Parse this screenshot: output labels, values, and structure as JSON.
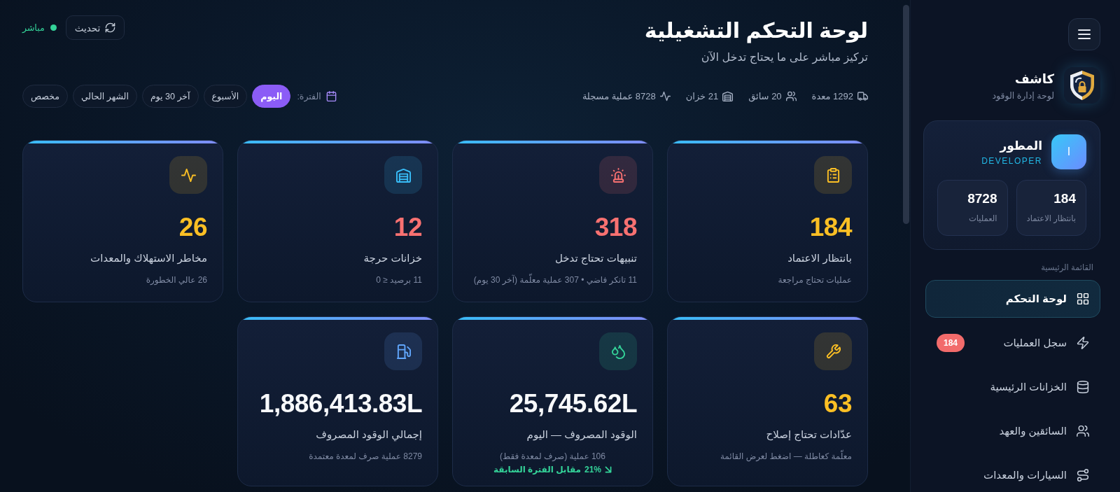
{
  "sidebar": {
    "brand": {
      "name": "كاشف",
      "tagline": "لوحة إدارة الوقود"
    },
    "user": {
      "avatar": "I",
      "name": "المطور",
      "role": "DEVELOPER",
      "stats": [
        {
          "value": "184",
          "label": "بانتظار الاعتماد"
        },
        {
          "value": "8728",
          "label": "العمليات"
        }
      ]
    },
    "menu_title": "القائمة الرئيسية",
    "items": [
      {
        "label": "لوحة التحكم",
        "selected": true
      },
      {
        "label": "سجل العمليات",
        "selected": false,
        "badge": "184"
      },
      {
        "label": "الخزانات الرئيسية",
        "selected": false
      },
      {
        "label": "السائقين والعهد",
        "selected": false
      },
      {
        "label": "السيارات والمعدات",
        "selected": false
      }
    ]
  },
  "header": {
    "title": "لوحة التحكم التشغيلية",
    "subtitle": "تركيز مباشر على ما يحتاج تدخل الآن",
    "refresh_button": "تحديث",
    "live": {
      "label": "مباشر",
      "on": true
    }
  },
  "summary": [
    "1292 معدة",
    "20 سائق",
    "21 خزان",
    "8728 عملية مسجلة"
  ],
  "period": {
    "label": "الفترة:",
    "options": [
      {
        "label": "اليوم",
        "selected": true
      },
      {
        "label": "الأسبوع",
        "selected": false
      },
      {
        "label": "آخر 30 يوم",
        "selected": false
      },
      {
        "label": "الشهر الحالي",
        "selected": false
      },
      {
        "label": "مخصص",
        "selected": false
      }
    ]
  },
  "cards": [
    {
      "kind": "warning",
      "value": "184",
      "label": "بانتظار الاعتماد",
      "note": "عمليات تحتاج مراجعة",
      "color": "#fbbf24"
    },
    {
      "kind": "danger",
      "value": "318",
      "label": "تنبيهات تحتاج تدخل",
      "note": "11 تانكر فاضي • 307 عملية معلّمة (آخر 30 يوم)",
      "color": "#f87171"
    },
    {
      "kind": "danger",
      "value": "12",
      "label": "خزانات حرجة",
      "note": "11 برصيد ≤ 0",
      "color": "#38bdf8"
    },
    {
      "kind": "warning",
      "value": "26",
      "label": "مخاطر الاستهلاك والمعدات",
      "note": "26 عالي الخطورة",
      "color": "#fbbf24"
    },
    {
      "kind": "warning",
      "value": "63",
      "label": "عدّادات تحتاج إصلاح",
      "note": "معلّمة كعاطلة — اضغط لعرض القائمة",
      "color": "#fbbf24"
    },
    {
      "kind": "plain",
      "value": "25,745.62L",
      "label": "الوقود المصروف — اليوم",
      "note": "106 عملية (صرف لمعدة فقط)",
      "color": "#34d399",
      "trend": {
        "falling": true,
        "value": "21%",
        "text": "مقابل الفترة السابقة"
      }
    },
    {
      "kind": "plain",
      "value": "1,886,413.83L",
      "label": "إجمالي الوقود المصروف",
      "note": "8279 عملية صرف لمعدة معتمدة",
      "color": "#60a5fa"
    }
  ]
}
